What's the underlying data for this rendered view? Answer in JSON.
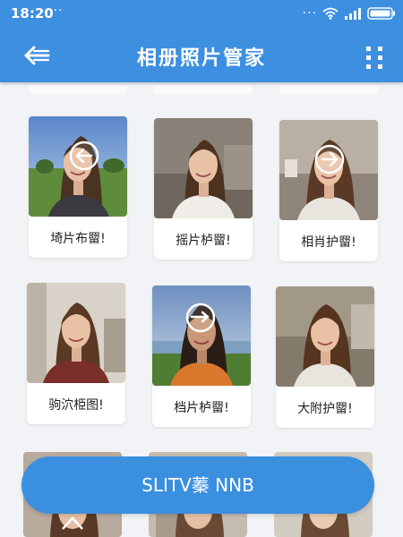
{
  "statusbar": {
    "time": "18:20",
    "left_dots": "···",
    "right_dots": "···",
    "icons": [
      "wifi-icon",
      "signal-icon",
      "battery-icon"
    ]
  },
  "appbar": {
    "title": "相册照片管家",
    "back_icon": "back-arrow-icon",
    "more_icon": "more-vertical-icon"
  },
  "photos": [
    {
      "label": "埼片布罶!",
      "overlay": "arrow-left-circle-icon"
    },
    {
      "label": "摇片栌罶!",
      "overlay": ""
    },
    {
      "label": "相肖护罶!",
      "overlay": "arrow-right-circle-icon"
    },
    {
      "label": "驹泬栕图!",
      "overlay": ""
    },
    {
      "label": "档片栌罶!",
      "overlay": "arrow-down-circle-icon"
    },
    {
      "label": "大附护罶!",
      "overlay": ""
    }
  ],
  "action_button": {
    "label": "SLITV蓁 NNB"
  },
  "colors": {
    "header": "#3d8fe0",
    "action_button": "#3b8fdf",
    "background": "#f1f3f6"
  }
}
